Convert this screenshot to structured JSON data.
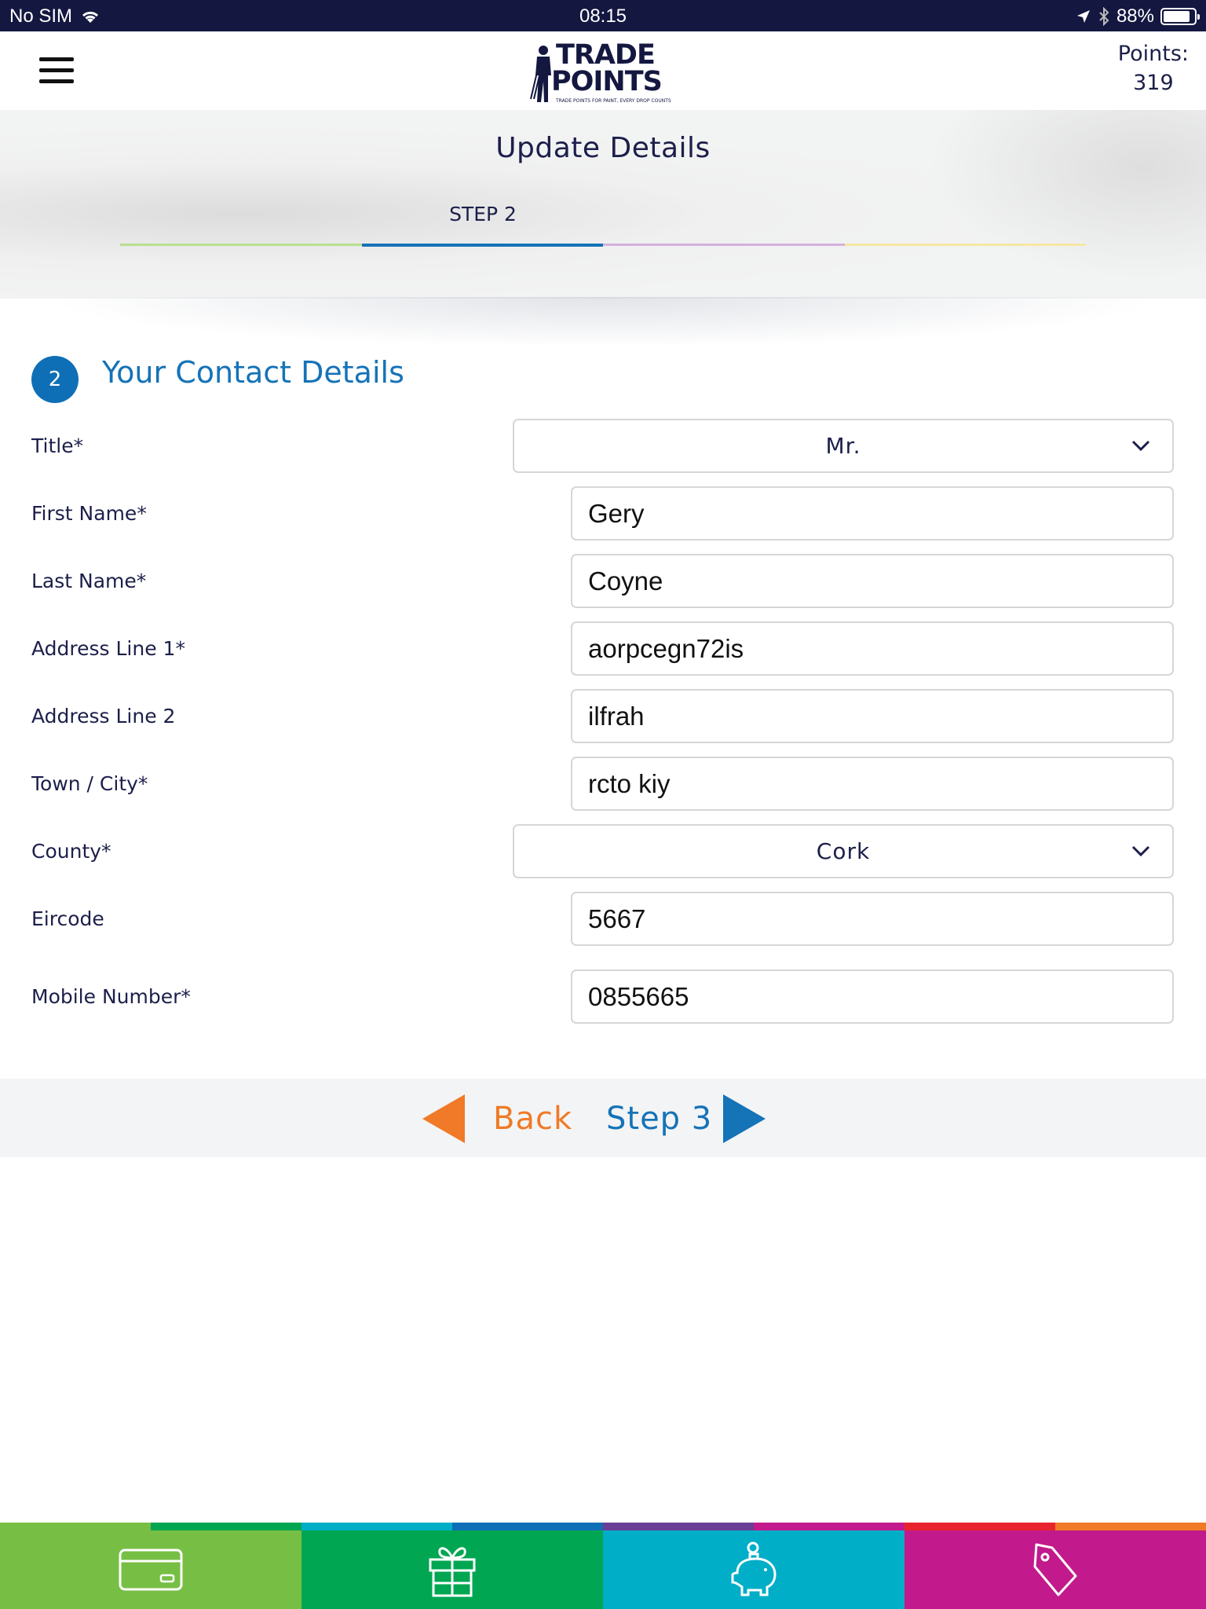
{
  "status_bar": {
    "carrier": "No SIM",
    "time": "08:15",
    "battery": "88%",
    "battery_level": 0.88
  },
  "header": {
    "logo_line1": "TRADE",
    "logo_line2": "POINTS",
    "logo_tagline": "TRADE POINTS FOR PAINT, EVERY DROP COUNTS",
    "points_label": "Points:",
    "points_value": "319"
  },
  "banner": {
    "title": "Update Details",
    "step_label": "STEP 2",
    "step_colors": [
      "#b9df91",
      "#1573b8",
      "#d5b0dc",
      "#f7e7a4"
    ],
    "active_step": 2
  },
  "section": {
    "number": "2",
    "title": "Your Contact Details"
  },
  "form": {
    "title_label": "Title*",
    "title_value": "Mr.",
    "first_name_label": "First Name*",
    "first_name_value": "Gery",
    "last_name_label": "Last Name*",
    "last_name_value": "Coyne",
    "address1_label": "Address Line 1*",
    "address1_value": "aorpcegn72is",
    "address2_label": "Address Line 2",
    "address2_value": "ilfrah",
    "town_label": "Town / City*",
    "town_value": "rcto kiy",
    "county_label": "County*",
    "county_value": "Cork",
    "eircode_label": "Eircode",
    "eircode_value": "5667",
    "mobile_label": "Mobile Number*",
    "mobile_value": "0855665"
  },
  "nav": {
    "back_label": "Back",
    "next_label": "Step 3",
    "back_color": "#f07a27",
    "next_color": "#1573b8"
  },
  "tabbar": {
    "tabs": [
      {
        "icon": "card-icon",
        "color": "#77bf44"
      },
      {
        "icon": "gift-icon",
        "color": "#00a651"
      },
      {
        "icon": "piggy-bank-icon",
        "color": "#00aec7"
      },
      {
        "icon": "price-tag-icon",
        "color": "#c21a8c"
      }
    ],
    "stripe_colors": [
      "#77bf44",
      "#00a651",
      "#00aec7",
      "#0f6fb6",
      "#6a3d97",
      "#c21a8c",
      "#e8232d",
      "#f07a27"
    ]
  }
}
